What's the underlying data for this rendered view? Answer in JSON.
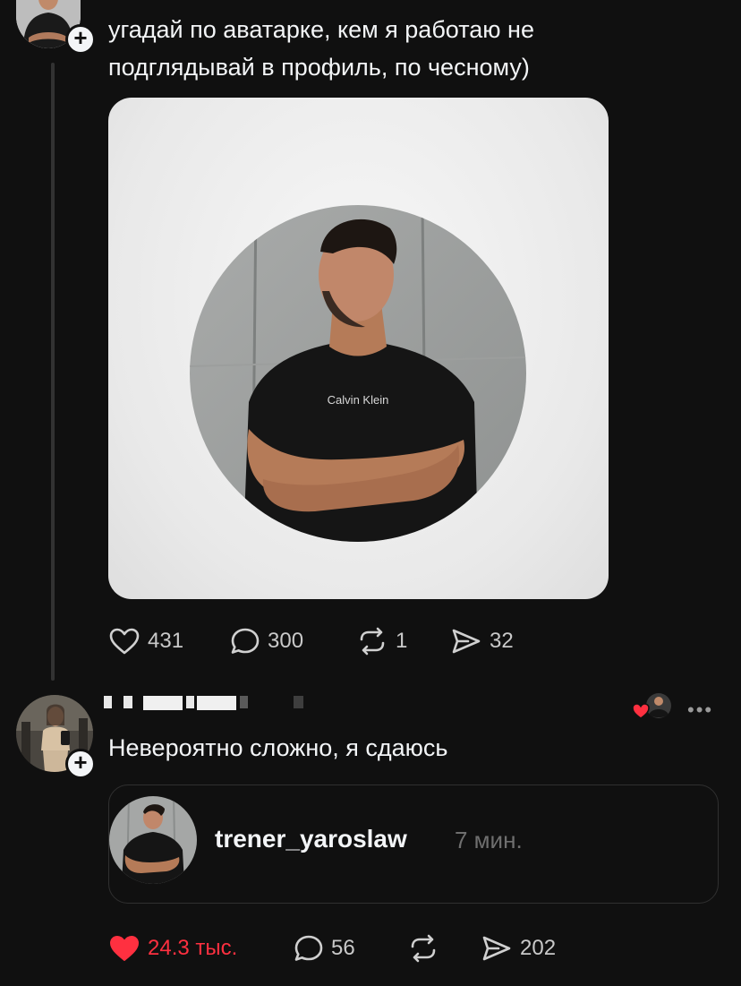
{
  "post": {
    "text_line1": "угадай по аватарке, кем я работаю не",
    "text_line2": "подглядывай в профиль, по чесному)",
    "image_shirt_brand": "Calvin Klein",
    "actions": {
      "likes": "431",
      "replies": "300",
      "reposts": "1",
      "shares": "32"
    }
  },
  "reply": {
    "text": "Невероятно сложно, я сдаюсь",
    "quote": {
      "username": "trener_yaroslaw",
      "time": "7 мин."
    },
    "actions": {
      "likes": "24.3 тыс.",
      "replies": "56",
      "shares": "202"
    }
  },
  "icons": {
    "like": "heart-icon",
    "reply": "speech-bubble-icon",
    "repost": "repost-arrows-icon",
    "share": "paper-plane-icon",
    "follow": "plus-icon",
    "more": "ellipsis-icon"
  },
  "colors": {
    "background": "#101010",
    "text": "#f3f5f7",
    "secondary": "#6f6f6f",
    "liked": "#ff3040"
  }
}
